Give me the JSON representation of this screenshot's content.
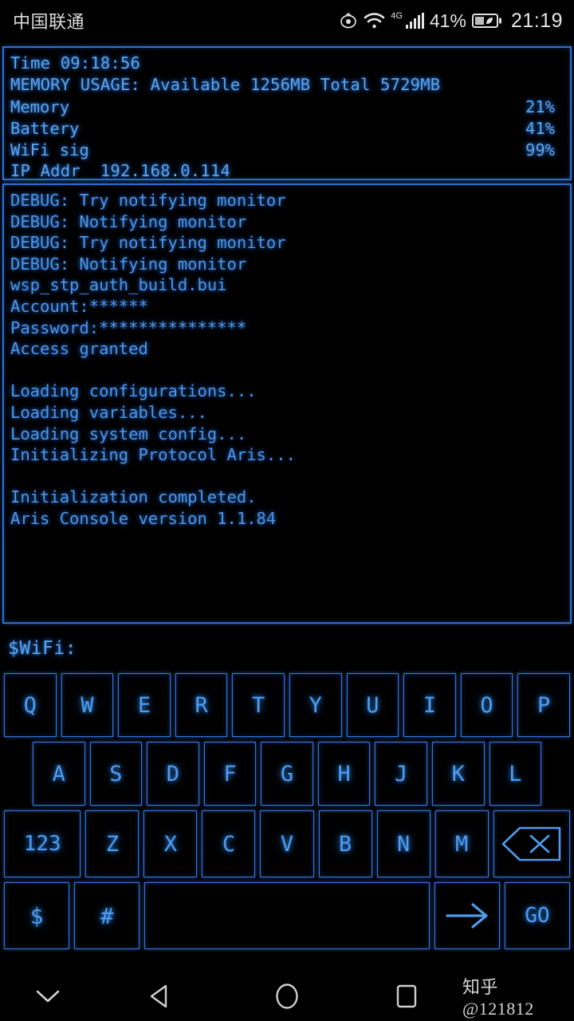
{
  "status_bar": {
    "carrier": "中国联通",
    "icons": [
      "eye-icon",
      "wifi-icon",
      "signal-icon",
      "battery-icon"
    ],
    "network_type": "4G",
    "battery_percent": "41%",
    "clock": "21:19"
  },
  "info_panel": {
    "time_line": "Time 09:18:56",
    "memory_line": "MEMORY USAGE: Available 1256MB Total 5729MB",
    "gauges": [
      {
        "label": "Memory  ",
        "value": 21,
        "value_text": "21%",
        "track_width": 530
      },
      {
        "label": "Battery ",
        "value": 41,
        "value_text": "41%",
        "track_width": 530
      },
      {
        "label": "WiFi sig",
        "value": 99,
        "value_text": "99%",
        "track_width": 530
      }
    ],
    "ip_label": "IP Addr  192.168.0.114"
  },
  "console": {
    "lines": [
      "DEBUG: Try notifying monitor",
      "DEBUG: Notifying monitor",
      "DEBUG: Try notifying monitor",
      "DEBUG: Notifying monitor",
      "wsp_stp_auth_build.bui",
      "Account:******",
      "Password:***************",
      "Access granted",
      "",
      "Loading configurations...",
      "Loading variables...",
      "Loading system config...",
      "Initializing Protocol Aris...",
      "",
      "Initialization completed.",
      "Aris Console version 1.1.84"
    ]
  },
  "prompt": {
    "text": "$WiFi:",
    "value": "",
    "placeholder": ""
  },
  "keyboard": {
    "row1": [
      "Q",
      "W",
      "E",
      "R",
      "T",
      "Y",
      "U",
      "I",
      "O",
      "P"
    ],
    "row2": [
      "A",
      "S",
      "D",
      "F",
      "G",
      "H",
      "J",
      "K",
      "L"
    ],
    "row3_num": "123",
    "row3": [
      "Z",
      "X",
      "C",
      "V",
      "B",
      "N",
      "M"
    ],
    "row3_backspace": "backspace-icon",
    "row4_dollar": "$",
    "row4_hash": "#",
    "row4_space": "",
    "row4_arrow": "arrow-right-icon",
    "row4_go": "GO"
  },
  "nav_bar": {
    "hide_keyboard": "chevron-down-icon",
    "back": "back-triangle-icon",
    "home": "home-circle-icon",
    "recents": "recents-square-icon",
    "watermark": "知乎 @121812"
  },
  "colors": {
    "accent": "#2e83d6",
    "text": "#5ba3ec",
    "border": "#2f6ecb",
    "background": "#000000"
  }
}
